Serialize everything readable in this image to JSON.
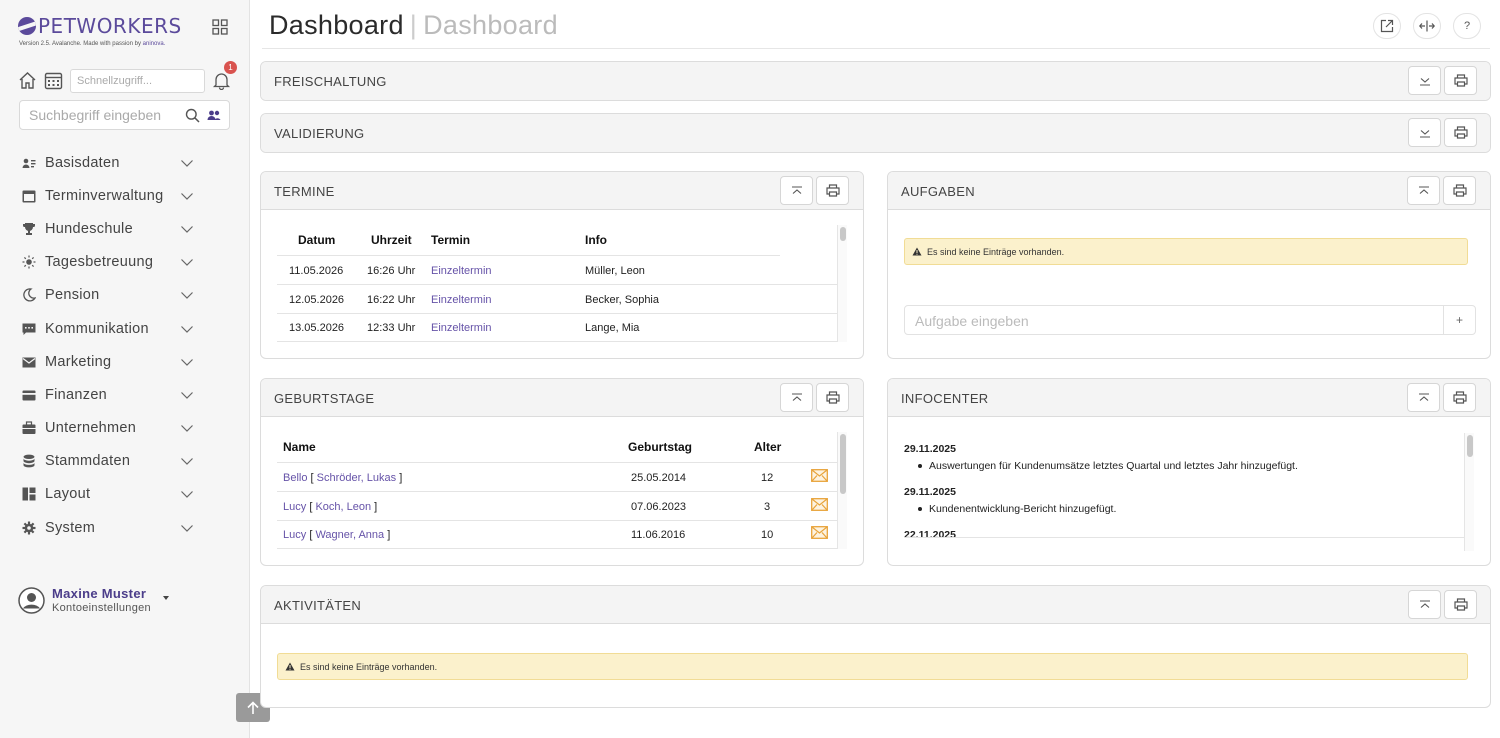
{
  "brand": {
    "name": "PETWORKERS",
    "version_text": "Version 2.5. Avalanche. Made with passion by",
    "maker": "aninova."
  },
  "quickbar": {
    "placeholder": "Schnellzugriff...",
    "notification_count": "1"
  },
  "search": {
    "placeholder": "Suchbegriff eingeben"
  },
  "nav": {
    "items": [
      {
        "label": "Basisdaten",
        "icon": "person-card-icon"
      },
      {
        "label": "Terminverwaltung",
        "icon": "calendar-icon"
      },
      {
        "label": "Hundeschule",
        "icon": "trophy-icon"
      },
      {
        "label": "Tagesbetreuung",
        "icon": "sun-icon"
      },
      {
        "label": "Pension",
        "icon": "moon-icon"
      },
      {
        "label": "Kommunikation",
        "icon": "chat-icon"
      },
      {
        "label": "Marketing",
        "icon": "mail-icon"
      },
      {
        "label": "Finanzen",
        "icon": "credit-card-icon"
      },
      {
        "label": "Unternehmen",
        "icon": "briefcase-icon"
      },
      {
        "label": "Stammdaten",
        "icon": "database-icon"
      },
      {
        "label": "Layout",
        "icon": "layout-icon"
      },
      {
        "label": "System",
        "icon": "gear-icon"
      }
    ]
  },
  "user": {
    "name": "Maxine Muster",
    "settings_label": "Kontoeinstellungen"
  },
  "header": {
    "title": "Dashboard",
    "separator": "|",
    "subtitle": "Dashboard",
    "help_label": "?"
  },
  "panels": {
    "freischaltung": {
      "title": "FREISCHALTUNG"
    },
    "validierung": {
      "title": "VALIDIERUNG"
    },
    "termine": {
      "title": "TERMINE",
      "columns": [
        "Datum",
        "Uhrzeit",
        "Termin",
        "Info"
      ],
      "rows": [
        {
          "datum": "11.05.2026",
          "uhrzeit": "16:26 Uhr",
          "termin": "Einzeltermin",
          "info": "Müller, Leon"
        },
        {
          "datum": "12.05.2026",
          "uhrzeit": "16:22 Uhr",
          "termin": "Einzeltermin",
          "info": "Becker, Sophia"
        },
        {
          "datum": "13.05.2026",
          "uhrzeit": "12:33 Uhr",
          "termin": "Einzeltermin",
          "info": "Lange, Mia"
        }
      ]
    },
    "aufgaben": {
      "title": "AUFGABEN",
      "empty_message": "Es sind keine Einträge vorhanden.",
      "input_placeholder": "Aufgabe eingeben",
      "add_label": "+"
    },
    "geburtstage": {
      "title": "GEBURTSTAGE",
      "columns": [
        "Name",
        "Geburtstag",
        "Alter"
      ],
      "rows": [
        {
          "pet": "Bello",
          "owner": "Schröder, Lukas",
          "geburtstag": "25.05.2014",
          "alter": "12"
        },
        {
          "pet": "Lucy",
          "owner": "Koch, Leon",
          "geburtstag": "07.06.2023",
          "alter": "3"
        },
        {
          "pet": "Lucy",
          "owner": "Wagner, Anna",
          "geburtstag": "11.06.2016",
          "alter": "10"
        }
      ],
      "bracket_open": "[",
      "bracket_close": "]"
    },
    "infocenter": {
      "title": "INFOCENTER",
      "entries": [
        {
          "date": "29.11.2025",
          "text": "Auswertungen für Kundenumsätze letztes Quartal und letztes Jahr hinzugefügt."
        },
        {
          "date": "29.11.2025",
          "text": "Kundenentwicklung-Bericht hinzugefügt."
        },
        {
          "date": "22.11.2025",
          "text": ""
        }
      ]
    },
    "aktivitaeten": {
      "title": "AKTIVITÄTEN",
      "empty_message": "Es sind keine Einträge vorhanden."
    }
  },
  "colors": {
    "brand": "#5b4a9b",
    "link": "#6653a8",
    "alert_bg": "#fbf1cc",
    "badge": "#d9534f",
    "mail": "#e8a33a"
  }
}
